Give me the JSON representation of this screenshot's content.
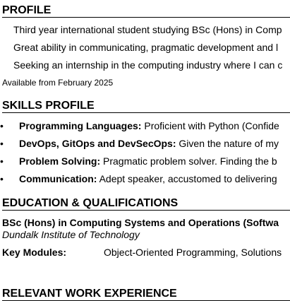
{
  "profile": {
    "title": "PROFILE",
    "lines": [
      "Third year international student studying BSc (Hons) in Comp",
      "Great ability in communicating, pragmatic development and l",
      "Seeking an internship in the computing industry where I can c"
    ],
    "availability": "Available from February 2025"
  },
  "skills": {
    "title": "SKILLS PROFILE",
    "items": [
      {
        "label": "Programming Languages:",
        "text": " Proficient with Python (Confide"
      },
      {
        "label": "DevOps, GitOps and DevSecOps:",
        "text": " Given the nature of my"
      },
      {
        "label": "Problem Solving:",
        "text": " Pragmatic problem solver. Finding the b"
      },
      {
        "label": "Communication:",
        "text": " Adept speaker, accustomed to delivering"
      }
    ]
  },
  "education": {
    "title": "EDUCATION & QUALIFICATIONS",
    "degree": "BSc (Hons) in Computing Systems and Operations (Softwa",
    "institution": "Dundalk Institute of Technology",
    "modules_label": "Key Modules:",
    "modules_value": "Object-Oriented Programming, Solutions"
  },
  "experience": {
    "title": "RELEVANT WORK EXPERIENCE"
  }
}
